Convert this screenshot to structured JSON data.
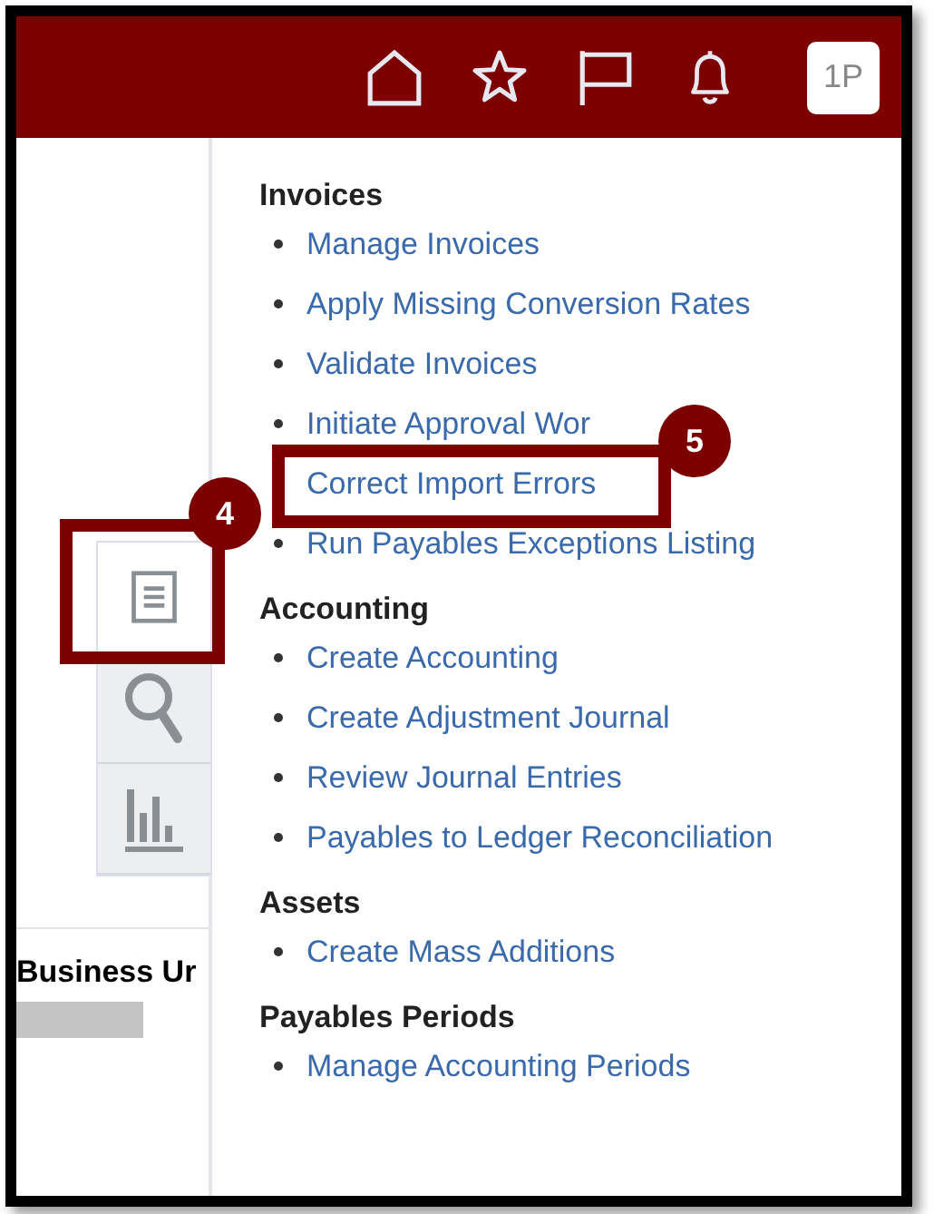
{
  "header": {
    "icons": [
      {
        "kind": "home"
      },
      {
        "kind": "star"
      },
      {
        "kind": "flag"
      },
      {
        "kind": "bell"
      }
    ],
    "avatar": "1P"
  },
  "side_tabs": [
    {
      "kind": "document",
      "selected": true
    },
    {
      "kind": "search",
      "selected": false
    },
    {
      "kind": "chart",
      "selected": false
    }
  ],
  "column_label": "Business Ur",
  "menu": [
    {
      "heading": "Invoices",
      "items": [
        "Manage Invoices",
        "Apply Missing Conversion Rates",
        "Validate Invoices",
        "Initiate Approval Wor",
        "Correct Import Errors",
        "Run Payables Exceptions Listing"
      ]
    },
    {
      "heading": "Accounting",
      "items": [
        "Create Accounting",
        "Create Adjustment Journal",
        "Review Journal Entries",
        "Payables to Ledger Reconciliation"
      ]
    },
    {
      "heading": "Assets",
      "items": [
        "Create Mass Additions"
      ]
    },
    {
      "heading": "Payables Periods",
      "items": [
        "Manage Accounting Periods"
      ]
    }
  ],
  "callouts": [
    {
      "number": "4"
    },
    {
      "number": "5"
    }
  ]
}
